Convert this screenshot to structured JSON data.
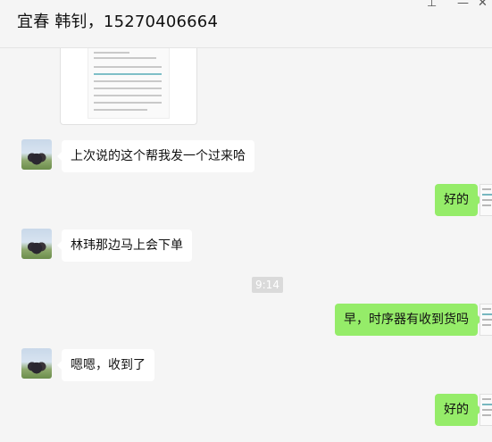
{
  "header": {
    "title": "宜春 韩钊，15270406664",
    "pin_icon": "pin-icon",
    "minimize_icon": "minimize-icon",
    "close_icon": "close-icon"
  },
  "messages": [
    {
      "side": "left",
      "text": "上次说的这个帮我发一个过来哈"
    },
    {
      "side": "right",
      "text": "好的"
    },
    {
      "side": "left",
      "text": "林玮那边马上会下单"
    },
    {
      "side": "time",
      "text": "9:14"
    },
    {
      "side": "right",
      "text": "早，时序器有收到货吗"
    },
    {
      "side": "left",
      "text": "嗯嗯，收到了"
    },
    {
      "side": "right",
      "text": "好的"
    }
  ],
  "colors": {
    "self_bubble": "#95ec69",
    "other_bubble": "#ffffff",
    "background": "#f5f5f5"
  }
}
